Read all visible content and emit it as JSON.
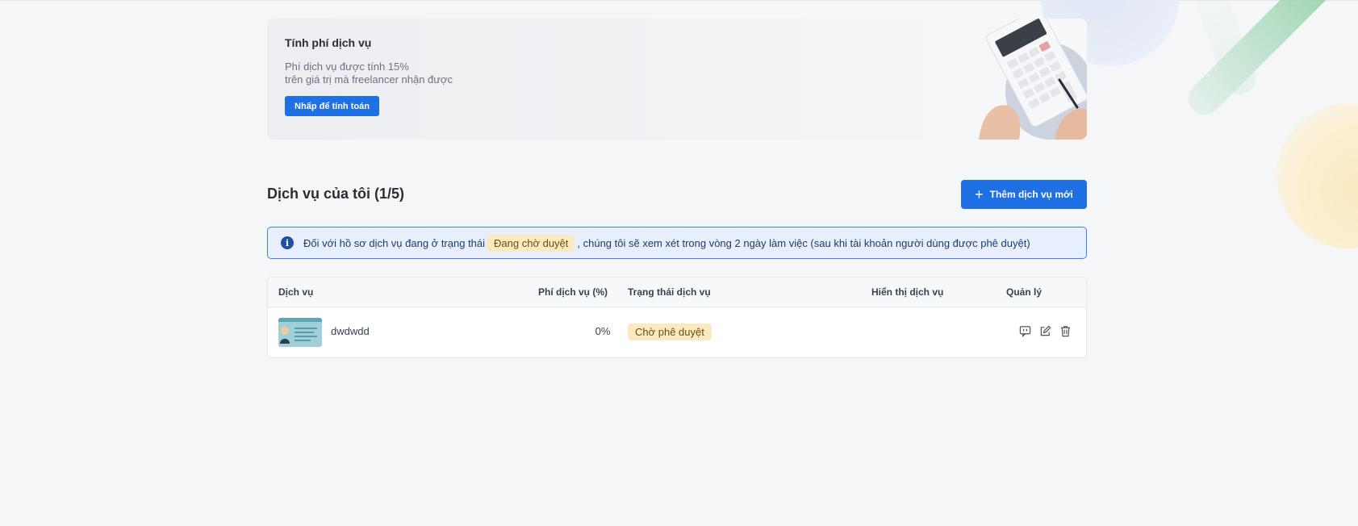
{
  "banner": {
    "title": "Tính phí dịch vụ",
    "desc_line1": "Phí dịch vụ được tính 15%",
    "desc_line2": "trên giá trị mà freelancer nhận được",
    "button_label": "Nhấp để tính toán",
    "image_icon": "calculator-hands-illustration"
  },
  "section": {
    "title": "Dịch vụ của tôi (1/5)",
    "add_button_label": "Thêm dịch vụ mới",
    "add_icon": "plus-icon"
  },
  "info_note": {
    "icon": "info-icon",
    "text_before": "Đối với hồ sơ dịch vụ đang ở trạng thái",
    "highlight": "Đang chờ duyệt",
    "text_after": ", chúng tôi sẽ xem xét trong vòng 2 ngày làm việc (sau khi tài khoản người dùng được phê duyệt)"
  },
  "table": {
    "columns": [
      "Dịch vụ",
      "Phí dịch vụ (%)",
      "Trạng thái dịch vụ",
      "Hiển thị dịch vụ",
      "Quản lý"
    ],
    "rows": [
      {
        "thumbnail_icon": "id-card-thumbnail",
        "name": "dwdwdd",
        "fee": "0%",
        "status": "Chờ phê duyệt",
        "actions": [
          "comment-icon",
          "edit-icon",
          "trash-icon"
        ]
      }
    ]
  },
  "colors": {
    "primary": "#1f6fe5",
    "page_bg": "#f5f6f8",
    "pending_bg": "#fbeac0",
    "info_border": "#3b82f6",
    "info_bg": "#e8effc"
  }
}
